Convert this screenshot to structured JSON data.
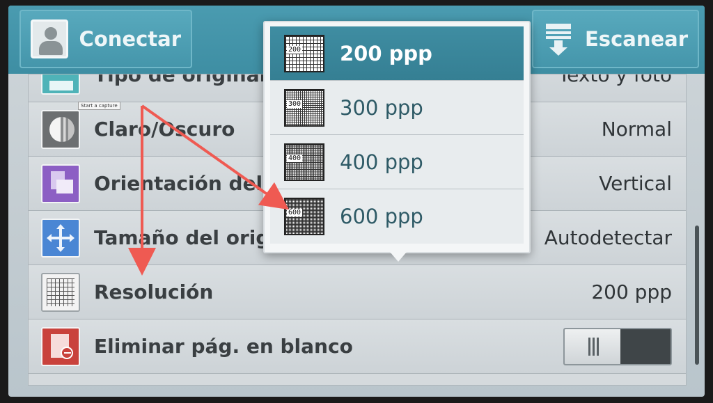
{
  "header": {
    "connect_label": "Conectar",
    "scan_label": "Escanear"
  },
  "list": {
    "rows": [
      {
        "label": "Tipo de original",
        "value": "Texto y foto"
      },
      {
        "label": "Claro/Oscuro",
        "value": "Normal"
      },
      {
        "label": "Orientación del",
        "value": "Vertical"
      },
      {
        "label": "Tamaño del orig",
        "value": "Autodetectar"
      },
      {
        "label": "Resolución",
        "value": "200 ppp"
      },
      {
        "label": "Eliminar pág. en blanco",
        "value": ""
      }
    ]
  },
  "popup": {
    "options": [
      {
        "badge": "200",
        "label": "200 ppp",
        "selected": true
      },
      {
        "badge": "300",
        "label": "300 ppp",
        "selected": false
      },
      {
        "badge": "400",
        "label": "400 ppp",
        "selected": false
      },
      {
        "badge": "600",
        "label": "600 ppp",
        "selected": false
      }
    ]
  },
  "tooltip": "Start a capture",
  "colors": {
    "accent": "#3f8da2",
    "annotation_arrow": "#ef5a52"
  }
}
